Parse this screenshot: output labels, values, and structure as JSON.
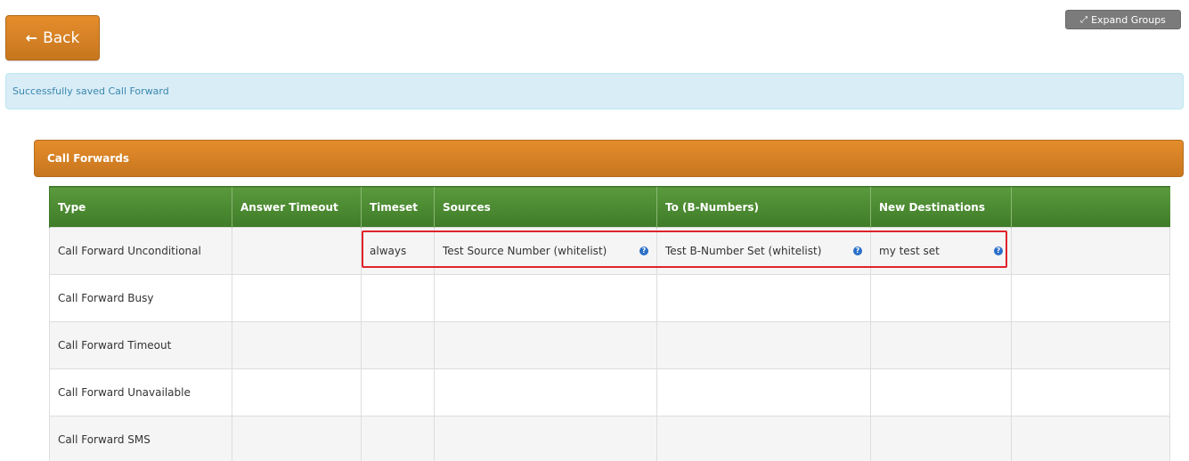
{
  "toolbar": {
    "expand_label": "Expand Groups",
    "back_label": "Back"
  },
  "alert": {
    "message": "Successfully saved Call Forward"
  },
  "panel": {
    "title": "Call Forwards"
  },
  "table": {
    "headers": [
      "Type",
      "Answer Timeout",
      "Timeset",
      "Sources",
      "To (B-Numbers)",
      "New Destinations",
      ""
    ],
    "rows": [
      {
        "type": "Call Forward Unconditional",
        "answer_timeout": "",
        "timeset": "always",
        "sources": "Test Source Number (whitelist)",
        "to": "Test B-Number Set (whitelist)",
        "destinations": "my test set",
        "extra": ""
      },
      {
        "type": "Call Forward Busy",
        "answer_timeout": "",
        "timeset": "",
        "sources": "",
        "to": "",
        "destinations": "",
        "extra": ""
      },
      {
        "type": "Call Forward Timeout",
        "answer_timeout": "",
        "timeset": "",
        "sources": "",
        "to": "",
        "destinations": "",
        "extra": ""
      },
      {
        "type": "Call Forward Unavailable",
        "answer_timeout": "",
        "timeset": "",
        "sources": "",
        "to": "",
        "destinations": "",
        "extra": ""
      },
      {
        "type": "Call Forward SMS",
        "answer_timeout": "",
        "timeset": "",
        "sources": "",
        "to": "",
        "destinations": "",
        "extra": ""
      }
    ]
  },
  "icons": {
    "expand": "expand-arrows-icon",
    "back": "arrow-left-icon",
    "help": "question-circle-icon"
  },
  "colors": {
    "brand_orange": "#e58d2c",
    "header_green": "#4a8a32",
    "alert_bg": "#d9edf7",
    "highlight": "#e0232c"
  }
}
